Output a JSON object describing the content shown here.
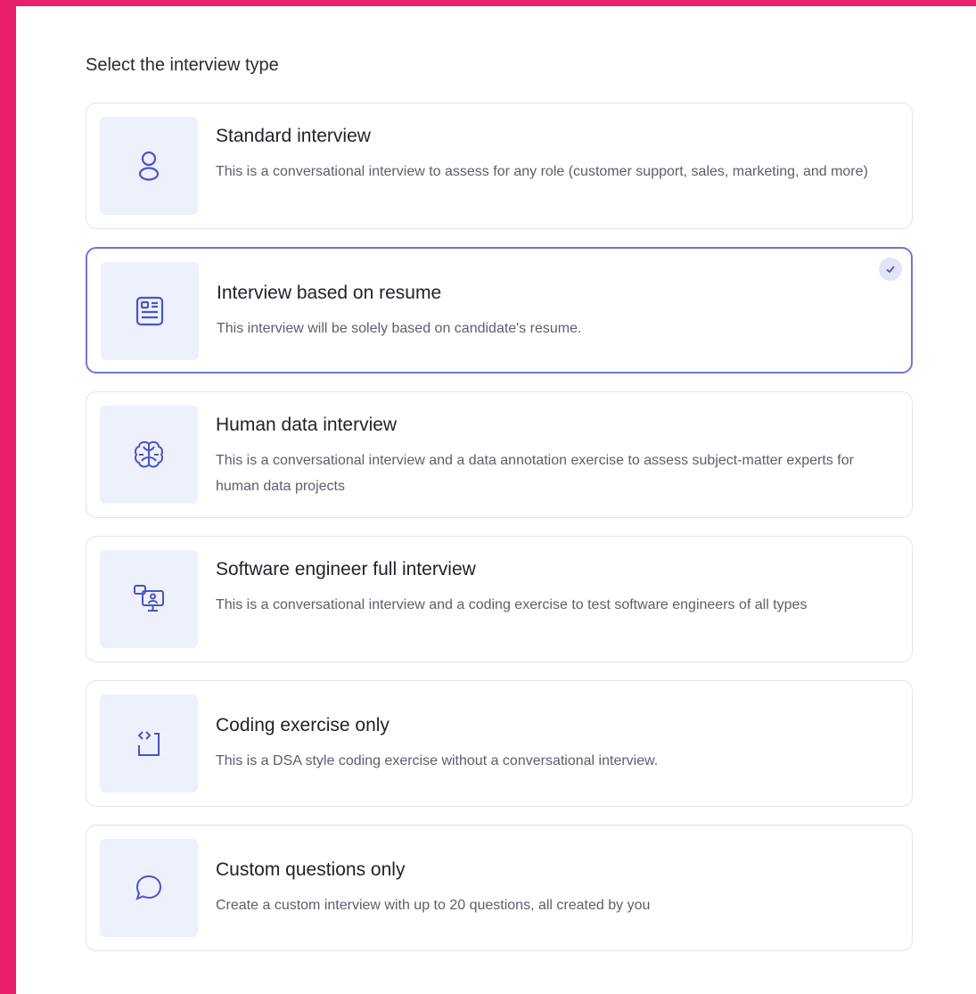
{
  "heading": "Select the interview type",
  "accent_color": "#6f78d6",
  "frame_color": "#e8206d",
  "options": [
    {
      "icon": "person-icon",
      "title": "Standard interview",
      "description": "This is a conversational interview to assess for any role (customer support, sales, marketing, and more)",
      "selected": false
    },
    {
      "icon": "resume-document-icon",
      "title": "Interview based on resume",
      "description": "This interview will be solely based on candidate's resume.",
      "selected": true
    },
    {
      "icon": "brain-icon",
      "title": "Human data interview",
      "description": "This is a conversational interview and a data annotation exercise to assess subject-matter experts for human data projects",
      "selected": false
    },
    {
      "icon": "computer-user-icon",
      "title": "Software engineer full interview",
      "description": "This is a conversational interview and a coding exercise to test software engineers of all types",
      "selected": false
    },
    {
      "icon": "code-brackets-icon",
      "title": "Coding exercise only",
      "description": "This is a DSA style coding exercise without a conversational interview.",
      "selected": false
    },
    {
      "icon": "chat-bubble-icon",
      "title": "Custom questions only",
      "description": "Create a custom interview with up to 20 questions, all created by you",
      "selected": false
    }
  ]
}
